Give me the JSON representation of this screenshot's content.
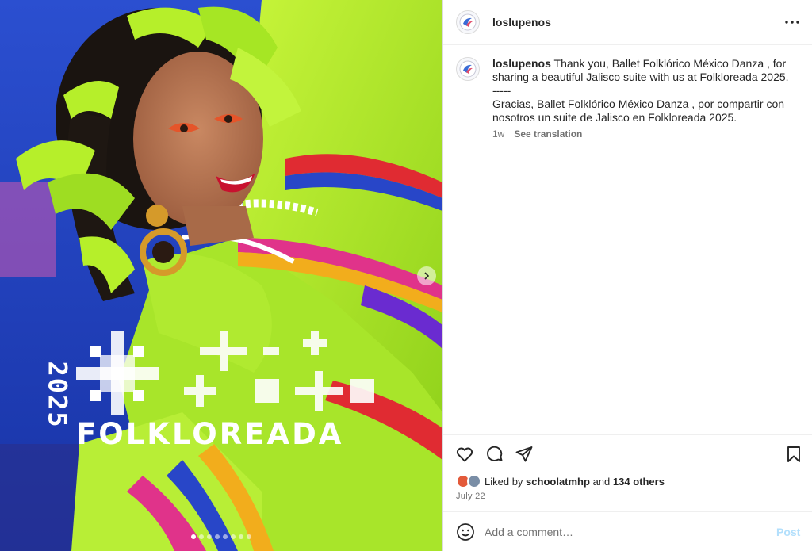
{
  "post": {
    "username": "loslupenos",
    "more_icon": "more-horizontal-icon"
  },
  "media": {
    "graphic_year": "2025",
    "graphic_title": "FOLKLOREADA",
    "carousel_total": 8,
    "carousel_active": 1,
    "next_icon": "chevron-right-icon",
    "colors": {
      "background_blue": "#1e3db8",
      "dress_green": "#b6ef2a",
      "accent_red": "#d8262a"
    }
  },
  "caption": {
    "username": "loslupenos",
    "line1": "Thank you, Ballet Folklórico México Danza , for sharing a beautiful Jalisco suite with us at Folkloreada 2025.",
    "separator": "-----",
    "line2": "Gracias, Ballet Folklórico México Danza , por compartir con nosotros un suite de Jalisco en Folkloreada 2025.",
    "age": "1w",
    "see_translation": "See translation"
  },
  "actions": {
    "like_icon": "heart-icon",
    "comment_icon": "comment-icon",
    "share_icon": "send-icon",
    "save_icon": "bookmark-icon"
  },
  "likes": {
    "prefix": "Liked by",
    "user": "schoolatmhp",
    "joiner": "and",
    "others": "134 others"
  },
  "date": "July 22",
  "comment_box": {
    "emoji_icon": "emoji-icon",
    "placeholder": "Add a comment…",
    "post_label": "Post",
    "post_color": "#b2dffc"
  }
}
